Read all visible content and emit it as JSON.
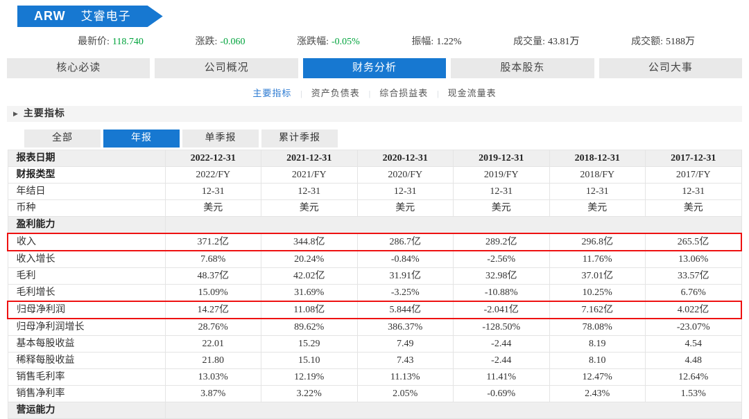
{
  "colors": {
    "accent": "#1778d1",
    "green": "#00a33c",
    "red": "#ee1111"
  },
  "banner": {
    "ticker": "ARW",
    "name": "艾睿电子"
  },
  "quote": {
    "items": [
      {
        "label": "最新价:",
        "value": "118.740",
        "green": true
      },
      {
        "label": "涨跌:",
        "value": "-0.060",
        "green": true
      },
      {
        "label": "涨跌幅:",
        "value": "-0.05%",
        "green": true
      },
      {
        "label": "振幅:",
        "value": "1.22%",
        "green": false
      },
      {
        "label": "成交量:",
        "value": "43.81万",
        "green": false
      },
      {
        "label": "成交额:",
        "value": "5188万",
        "green": false
      }
    ]
  },
  "main_tabs": {
    "items": [
      {
        "label": "核心必读",
        "active": false
      },
      {
        "label": "公司概况",
        "active": false
      },
      {
        "label": "财务分析",
        "active": true
      },
      {
        "label": "股本股东",
        "active": false
      },
      {
        "label": "公司大事",
        "active": false
      }
    ]
  },
  "subnav": {
    "items": [
      {
        "label": "主要指标",
        "active": true
      },
      {
        "label": "资产负债表",
        "active": false
      },
      {
        "label": "综合损益表",
        "active": false
      },
      {
        "label": "现金流量表",
        "active": false
      }
    ],
    "separator": "|"
  },
  "section": {
    "arrow_icon": "▶",
    "title": "主要指标"
  },
  "period_tabs": {
    "items": [
      {
        "label": "全部",
        "active": false
      },
      {
        "label": "年报",
        "active": true
      },
      {
        "label": "单季报",
        "active": false
      },
      {
        "label": "累计季报",
        "active": false
      }
    ]
  },
  "table": {
    "header": {
      "label": "报表日期",
      "columns": [
        "2022-12-31",
        "2021-12-31",
        "2020-12-31",
        "2019-12-31",
        "2018-12-31",
        "2017-12-31"
      ]
    },
    "rows": [
      {
        "type": "data",
        "label": "财报类型",
        "bold_label": true,
        "values": [
          "2022/FY",
          "2021/FY",
          "2020/FY",
          "2019/FY",
          "2018/FY",
          "2017/FY"
        ]
      },
      {
        "type": "data",
        "label": "年结日",
        "values": [
          "12-31",
          "12-31",
          "12-31",
          "12-31",
          "12-31",
          "12-31"
        ]
      },
      {
        "type": "data",
        "label": "币种",
        "values": [
          "美元",
          "美元",
          "美元",
          "美元",
          "美元",
          "美元"
        ]
      },
      {
        "type": "section",
        "label": "盈利能力"
      },
      {
        "type": "data",
        "label": "收入",
        "highlight": true,
        "values": [
          "371.2亿",
          "344.8亿",
          "286.7亿",
          "289.2亿",
          "296.8亿",
          "265.5亿"
        ]
      },
      {
        "type": "data",
        "label": "收入增长",
        "values": [
          "7.68%",
          "20.24%",
          "-0.84%",
          "-2.56%",
          "11.76%",
          "13.06%"
        ]
      },
      {
        "type": "data",
        "label": "毛利",
        "values": [
          "48.37亿",
          "42.02亿",
          "31.91亿",
          "32.98亿",
          "37.01亿",
          "33.57亿"
        ]
      },
      {
        "type": "data",
        "label": "毛利增长",
        "values": [
          "15.09%",
          "31.69%",
          "-3.25%",
          "-10.88%",
          "10.25%",
          "6.76%"
        ]
      },
      {
        "type": "data",
        "label": "归母净利润",
        "highlight": true,
        "values": [
          "14.27亿",
          "11.08亿",
          "5.844亿",
          "-2.041亿",
          "7.162亿",
          "4.022亿"
        ]
      },
      {
        "type": "data",
        "label": "归母净利润增长",
        "values": [
          "28.76%",
          "89.62%",
          "386.37%",
          "-128.50%",
          "78.08%",
          "-23.07%"
        ]
      },
      {
        "type": "data",
        "label": "基本每股收益",
        "values": [
          "22.01",
          "15.29",
          "7.49",
          "-2.44",
          "8.19",
          "4.54"
        ]
      },
      {
        "type": "data",
        "label": "稀释每股收益",
        "values": [
          "21.80",
          "15.10",
          "7.43",
          "-2.44",
          "8.10",
          "4.48"
        ]
      },
      {
        "type": "data",
        "label": "销售毛利率",
        "values": [
          "13.03%",
          "12.19%",
          "11.13%",
          "11.41%",
          "12.47%",
          "12.64%"
        ]
      },
      {
        "type": "data",
        "label": "销售净利率",
        "values": [
          "3.87%",
          "3.22%",
          "2.05%",
          "-0.69%",
          "2.43%",
          "1.53%"
        ]
      },
      {
        "type": "section",
        "label": "营运能力"
      }
    ]
  }
}
